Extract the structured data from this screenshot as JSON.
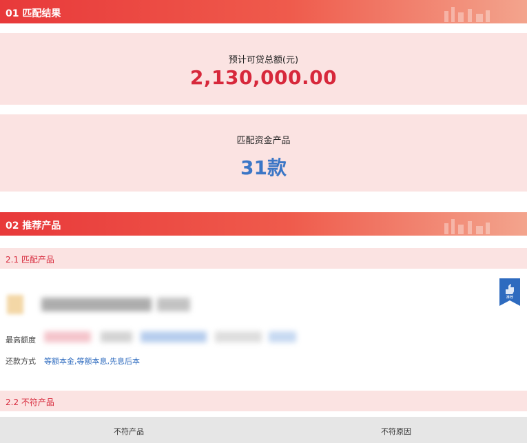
{
  "section1": {
    "title": "01 匹配结果",
    "total_label": "预计可贷总额(元)",
    "total_amount": "2,130,000.00",
    "products_label": "匹配资金产品",
    "products_count": "31款"
  },
  "section2": {
    "title": "02 推荐产品",
    "matched": {
      "heading": "2.1 匹配产品",
      "max_amount_label": "最高额度",
      "repayment_label": "还款方式",
      "repayment_value": "等额本金,等额本息,先息后本",
      "badge_text": "推荐"
    },
    "unmatched": {
      "heading": "2.2 不符产品",
      "columns": [
        "不符产品",
        "不符原因"
      ]
    }
  }
}
